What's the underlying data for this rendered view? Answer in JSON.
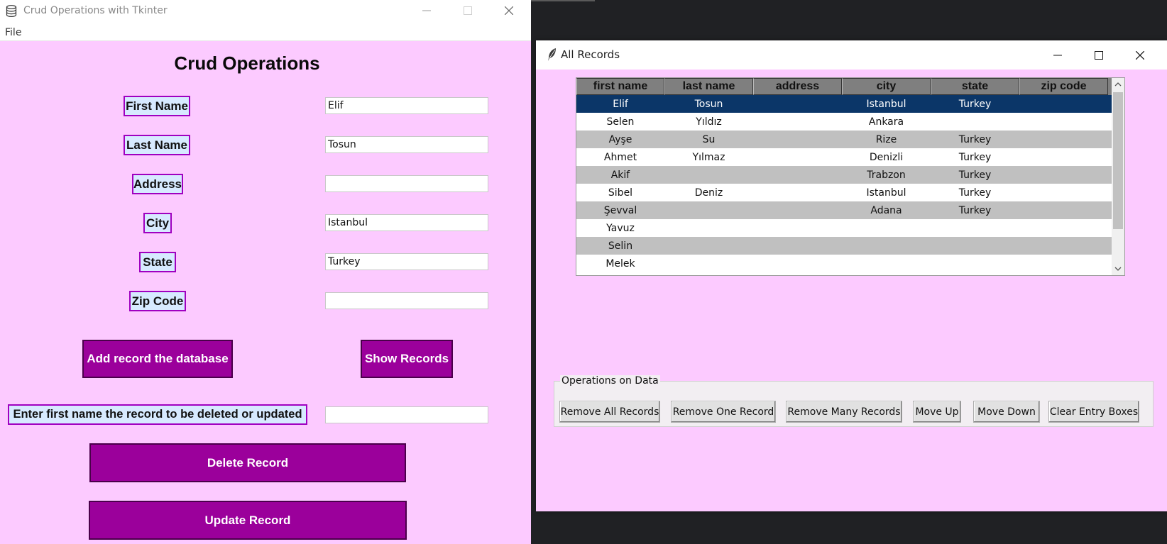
{
  "main_window": {
    "title": "Crud Operations with Tkinter",
    "menu": {
      "file": "File"
    },
    "heading": "Crud Operations",
    "fields": [
      {
        "label": "First Name",
        "value": "Elif"
      },
      {
        "label": "Last Name",
        "value": "Tosun"
      },
      {
        "label": "Address",
        "value": ""
      },
      {
        "label": "City",
        "value": "Istanbul"
      },
      {
        "label": "State",
        "value": "Turkey"
      },
      {
        "label": "Zip Code",
        "value": ""
      }
    ],
    "add_button": "Add record the database",
    "show_button": "Show Records",
    "delete_prompt": "Enter first name the record to be deleted or updated",
    "delete_entry_value": "",
    "delete_button": "Delete Record",
    "update_button": "Update Record"
  },
  "records_window": {
    "title": "All Records",
    "columns": [
      "first name",
      "last name",
      "address",
      "city",
      "state",
      "zip code"
    ],
    "rows": [
      [
        "Elif",
        "Tosun",
        "",
        "Istanbul",
        "Turkey",
        ""
      ],
      [
        "Selen",
        "Yıldız",
        "",
        "Ankara",
        "",
        ""
      ],
      [
        "Ayşe",
        "Su",
        "",
        "Rize",
        "Turkey",
        ""
      ],
      [
        "Ahmet",
        "Yılmaz",
        "",
        "Denizli",
        "Turkey",
        ""
      ],
      [
        "Akif",
        "",
        "",
        "Trabzon",
        "Turkey",
        ""
      ],
      [
        "Sibel",
        "Deniz",
        "",
        "Istanbul",
        "Turkey",
        ""
      ],
      [
        "Şevval",
        "",
        "",
        "Adana",
        "Turkey",
        ""
      ],
      [
        "Yavuz",
        "",
        "",
        "",
        "",
        ""
      ],
      [
        "Selin",
        "",
        "",
        "",
        "",
        ""
      ],
      [
        "Melek",
        "",
        "",
        "",
        "",
        ""
      ]
    ],
    "selected_row": 0,
    "operations": {
      "legend": "Operations on Data",
      "buttons": [
        "Remove All Records",
        "Remove One Record",
        "Remove Many Records",
        "Move Up",
        "Move Down",
        "Clear Entry Boxes"
      ]
    }
  },
  "colors": {
    "window_bg": "#fccaff",
    "purple_button": "#9b009b",
    "label_bg": "#d7eaff",
    "selected_row": "#0b3668",
    "odd_row": "#c0c0c0"
  },
  "icons": {
    "main_app": "database-icon",
    "records_app": "feather-icon",
    "controls": [
      "minimize-icon",
      "maximize-icon",
      "close-icon"
    ]
  }
}
